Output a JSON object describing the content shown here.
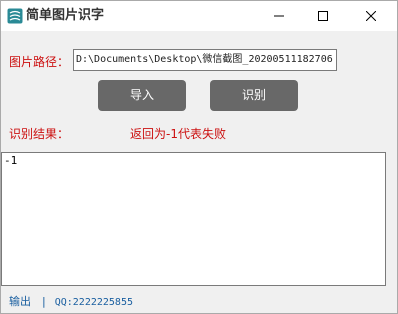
{
  "window": {
    "title": "简单图片识字",
    "icon": "app-logo-icon",
    "controls": [
      "minimize-icon",
      "maximize-icon",
      "close-icon"
    ]
  },
  "form": {
    "path_label": "图片路径：",
    "path_value": "D:\\Documents\\Desktop\\微信截图_20200511182706",
    "import_label": "导入",
    "recognize_label": "识别",
    "result_label": "识别结果：",
    "result_status": "返回为-1代表失败"
  },
  "output": {
    "text": "-1"
  },
  "footer": {
    "output_link": "输出",
    "separator": "|",
    "qq": "QQ:2222225855"
  },
  "colors": {
    "label_red": "#cc1111",
    "button_gray": "#686868",
    "footer_blue": "#1a5fa0",
    "logo_teal": "#2a8a96"
  }
}
